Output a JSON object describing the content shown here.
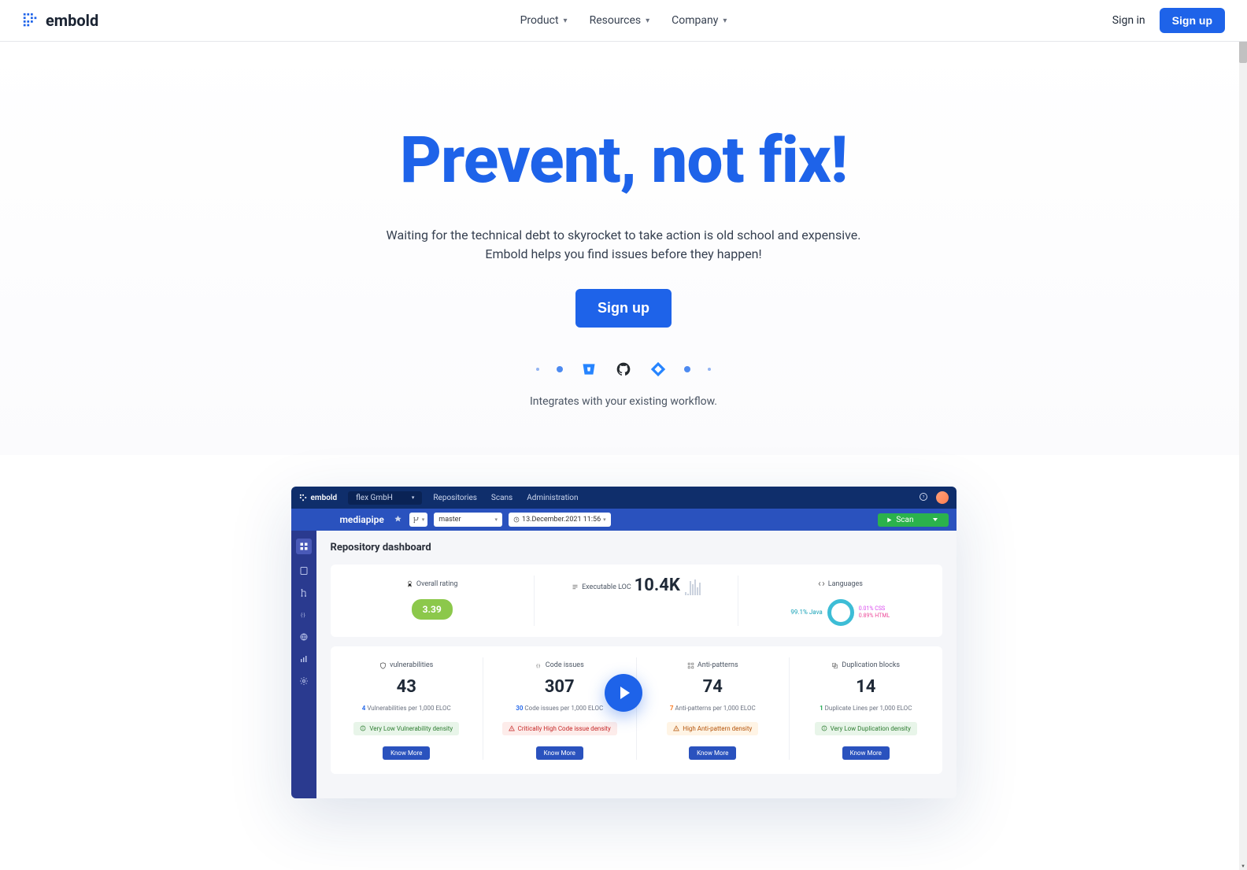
{
  "header": {
    "brand": "embold",
    "nav": {
      "product": "Product",
      "resources": "Resources",
      "company": "Company"
    },
    "signin": "Sign in",
    "signup": "Sign up"
  },
  "hero": {
    "headline": "Prevent, not fix!",
    "sub1": "Waiting for the technical debt to skyrocket to take action is old school and expensive.",
    "sub2": "Embold helps you find issues before they happen!",
    "cta": "Sign up",
    "integrates": "Integrates with your existing workflow."
  },
  "mock": {
    "brand": "embold",
    "org": "flex GmbH",
    "topnav": {
      "repos": "Repositories",
      "scans": "Scans",
      "admin": "Administration"
    },
    "repo": "mediapipe",
    "branch": "master",
    "date": "13.December.2021 11:56",
    "scan": "Scan",
    "dash_title": "Repository dashboard",
    "row1": {
      "overall": {
        "label": "Overall rating",
        "value": "3.39"
      },
      "loc": {
        "label": "Executable LOC",
        "value": "10.4K"
      },
      "lang": {
        "label": "Languages",
        "java": "99.1% Java",
        "css": "0.01% CSS",
        "html": "0.89% HTML"
      }
    },
    "row2": {
      "vuln": {
        "label": "vulnerabilities",
        "value": "43",
        "per_n": "4",
        "per_t": "Vulnerabilities per 1,000 ELOC",
        "density": "Very Low Vulnerability density",
        "cta": "Know More"
      },
      "code": {
        "label": "Code issues",
        "value": "307",
        "per_n": "30",
        "per_t": "Code issues per 1,000 ELOC",
        "density": "Critically High Code issue density",
        "cta": "Know More"
      },
      "anti": {
        "label": "Anti-patterns",
        "value": "74",
        "per_n": "7",
        "per_t": "Anti-patterns per 1,000 ELOC",
        "density": "High Anti-pattern density",
        "cta": "Know More"
      },
      "dup": {
        "label": "Duplication blocks",
        "value": "14",
        "per_n": "1",
        "per_t": "Duplicate Lines per 1,000 ELOC",
        "density": "Very Low Duplication density",
        "cta": "Know More"
      }
    }
  }
}
